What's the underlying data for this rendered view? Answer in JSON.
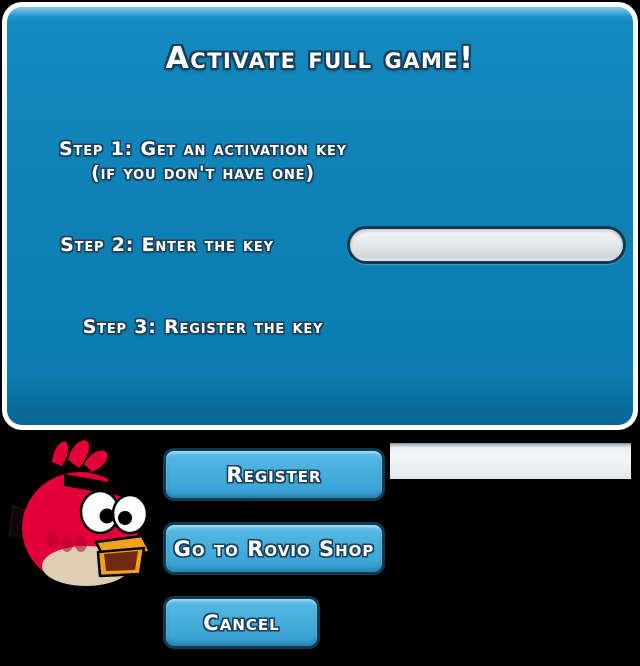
{
  "dialog": {
    "title": "Activate full game!",
    "steps": {
      "step1_line1": "Step 1: Get an activation key",
      "step1_line2": "(if you don't have one)",
      "step2": "Step 2: Enter the key",
      "step3": "Step 3: Register the key"
    },
    "key_input": {
      "value": "",
      "placeholder": ""
    }
  },
  "buttons": {
    "register": "Register",
    "shop": "Go to Rovio Shop",
    "cancel": "Cancel"
  },
  "colors": {
    "panel_blue": "#0e80b4",
    "panel_blue_light": "#39a9d6",
    "panel_border": "#ffffff",
    "button_blue": "#47aedc",
    "button_border": "#123a52",
    "text_white": "#ffffff",
    "text_outline": "#19425f",
    "bird_red": "#e30038",
    "bird_red_dark": "#c2002f",
    "bird_belly": "#ddcdb5",
    "beak_orange": "#f2a11c",
    "beak_mouth": "#6e2a10",
    "background": "#000000",
    "side_panel": "#f4f6f7"
  },
  "icons": {
    "bird": "angry-bird-red-character"
  }
}
